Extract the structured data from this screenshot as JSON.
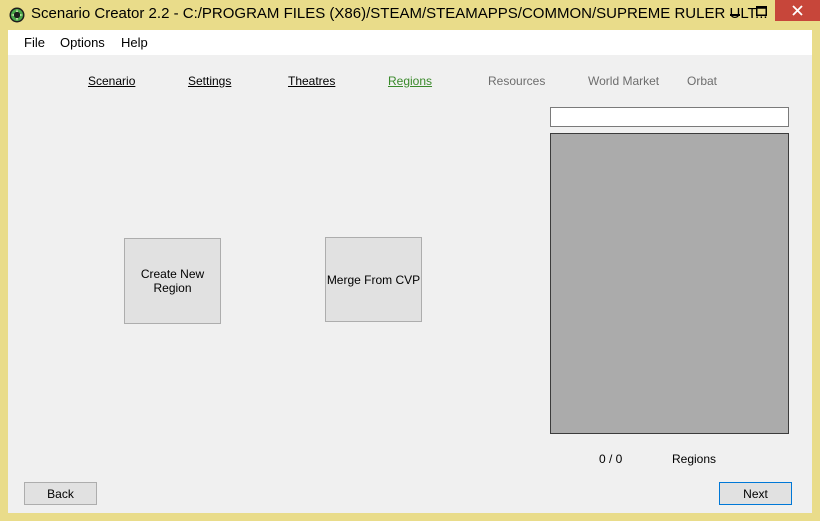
{
  "window": {
    "title": "Scenario Creator 2.2 - C:/PROGRAM FILES (X86)/STEAM/STEAMAPPS/COMMON/SUPREME RULER ULT...",
    "frame_color": "#e9dc8a",
    "close_color": "#c7463a"
  },
  "menu": {
    "file": "File",
    "options": "Options",
    "help": "Help"
  },
  "tabs": [
    {
      "label": "Scenario",
      "state": "link"
    },
    {
      "label": "Settings",
      "state": "link"
    },
    {
      "label": "Theatres",
      "state": "link"
    },
    {
      "label": "Regions",
      "state": "active"
    },
    {
      "label": "Resources",
      "state": "disabled"
    },
    {
      "label": "World Market",
      "state": "disabled"
    },
    {
      "label": "Orbat",
      "state": "disabled"
    }
  ],
  "actions": {
    "create_new_region": "Create New Region",
    "merge_from_cvp": "Merge From CVP"
  },
  "search": {
    "value": ""
  },
  "regions_list": {
    "count": "0 / 0",
    "label": "Regions"
  },
  "nav": {
    "back": "Back",
    "next": "Next"
  },
  "colors": {
    "active_tab": "#3a8a2b",
    "disabled_tab": "#6d6d6d",
    "list_bg": "#ababab"
  }
}
